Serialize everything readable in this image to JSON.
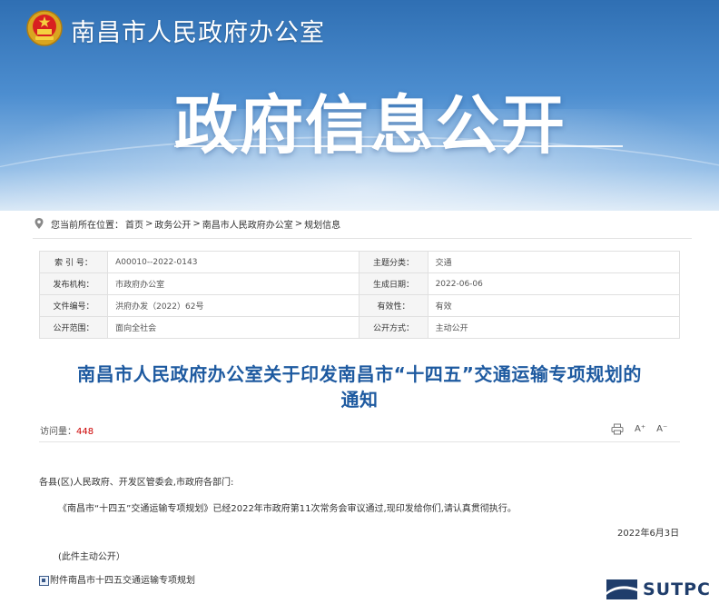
{
  "header": {
    "site_name": "南昌市人民政府办公室",
    "banner_title": "政府信息公开",
    "emblem_icon": "national-emblem-icon"
  },
  "breadcrumb": {
    "prefix": "您当前所在位置：",
    "items": [
      "首页",
      "政务公开",
      "南昌市人民政府办公室",
      "规划信息"
    ],
    "separator": ">"
  },
  "meta": {
    "rows": [
      {
        "label1": "索 引 号：",
        "value1": "A00010--2022-0143",
        "label2": "主题分类：",
        "value2": "交通"
      },
      {
        "label1": "发布机构：",
        "value1": "市政府办公室",
        "label2": "生成日期：",
        "value2": "2022-06-06"
      },
      {
        "label1": "文件编号：",
        "value1": "洪府办发（2022）62号",
        "label2": "有效性：",
        "value2": "有效"
      },
      {
        "label1": "公开范围：",
        "value1": "面向全社会",
        "label2": "公开方式：",
        "value2": "主动公开"
      }
    ]
  },
  "article": {
    "title_line1": "南昌市人民政府办公室关于印发南昌市“十四五”交通运输专项规划的",
    "title_line2": "通知",
    "visits_label": "访问量：",
    "visits_count": "448",
    "tools": {
      "print_icon": "print-icon",
      "font_larger": "A⁺",
      "font_smaller": "A⁻"
    },
    "salutation": "各县(区)人民政府、开发区管委会,市政府各部门:",
    "paragraph": "《南昌市“十四五”交通运输专项规划》已经2022年市政府第11次常务会审议通过,现印发给你们,请认真贯彻执行。",
    "date": "2022年6月3日",
    "disclosure": "(此件主动公开）",
    "attachment": "附件南昌市十四五交通运输专项规划"
  },
  "watermark": {
    "text": "SUTPC"
  },
  "colors": {
    "title_blue": "#1e5aa0",
    "header_blue": "#3f7fc4",
    "visits_red": "#cc0000"
  }
}
